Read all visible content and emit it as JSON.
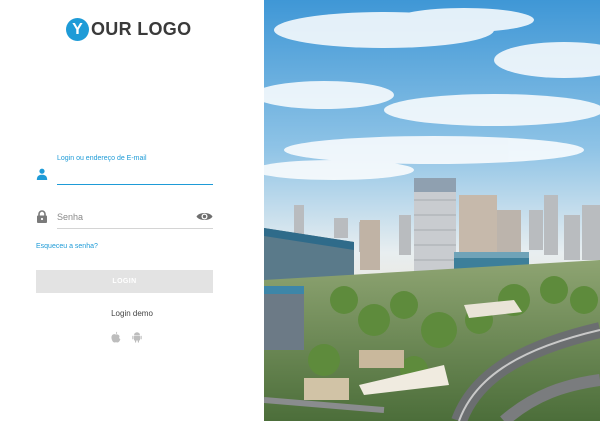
{
  "logo": {
    "letter": "Y",
    "text": "OUR LOGO"
  },
  "login_form": {
    "username_label": "Login ou endereço de E-mail",
    "username_value": "",
    "password_placeholder": "Senha",
    "forgot_password": "Esqueceu a senha?",
    "submit_label": "LOGIN"
  },
  "demo": {
    "label": "Login demo",
    "icons": [
      "apple-icon",
      "android-icon"
    ]
  },
  "colors": {
    "accent": "#1e9bd7",
    "button_disabled": "#e3e3e3",
    "icon_gray": "#7a7a7a"
  }
}
